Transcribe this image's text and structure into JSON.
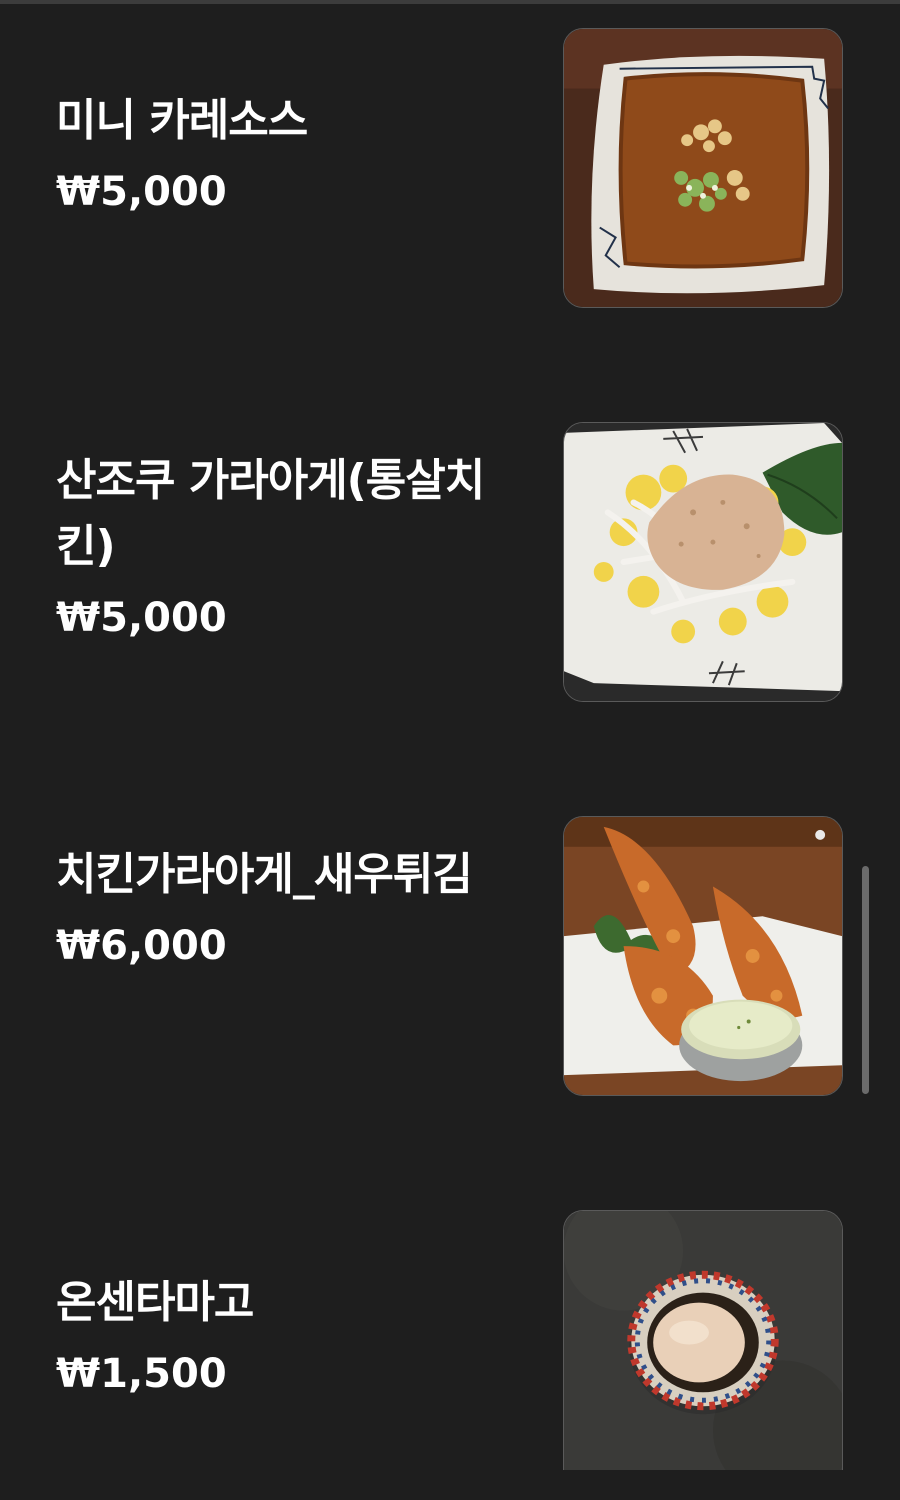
{
  "menu": {
    "items": [
      {
        "name": "미니 카레소스",
        "price": "₩5,000",
        "image_icon": "curry-sauce-photo"
      },
      {
        "name": "산조쿠 가라아게(통살치킨)",
        "price": "₩5,000",
        "image_icon": "sanzoku-karaage-photo"
      },
      {
        "name": "치킨가라아게_새우튀김",
        "price": "₩6,000",
        "image_icon": "fried-chicken-shrimp-photo"
      },
      {
        "name": "온센타마고",
        "price": "₩1,500",
        "image_icon": "onsen-tamago-photo"
      }
    ]
  },
  "colors": {
    "background": "#1e1e1e",
    "text": "#ffffff",
    "scrollbar": "#6b6b6b"
  }
}
